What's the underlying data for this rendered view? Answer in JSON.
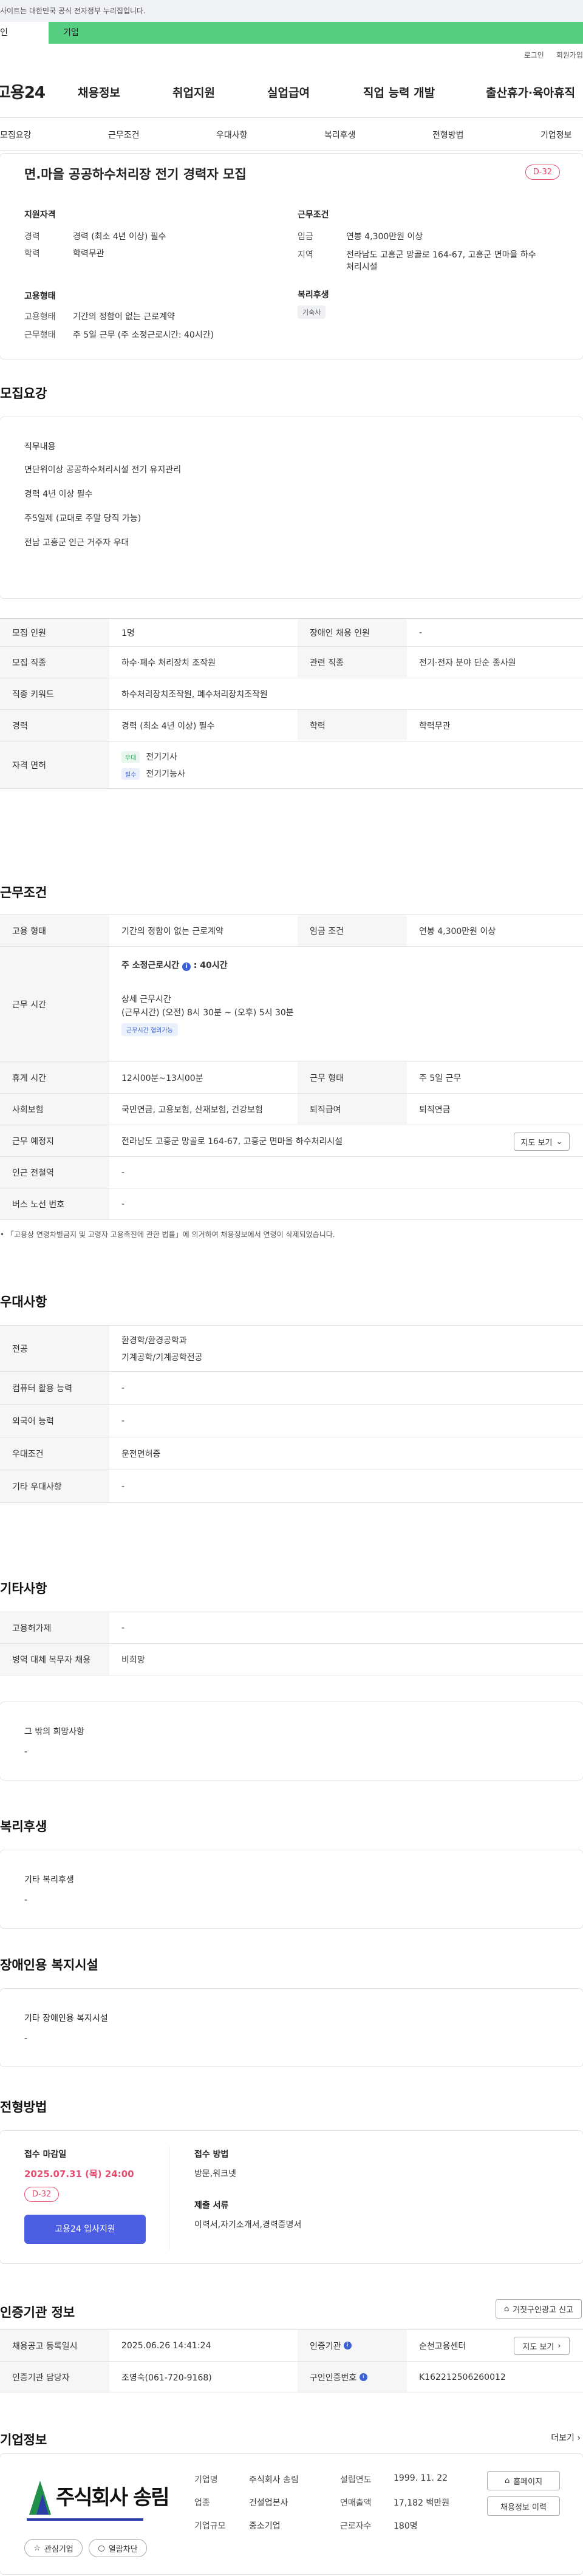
{
  "topbar": {
    "notice": "사이트는 대한민국 공식 전자정부 누리집입니다."
  },
  "tabs": {
    "first": "인",
    "second": "기업"
  },
  "util": {
    "login": "로그인",
    "join": "회원가입"
  },
  "gnb": {
    "logo": "고용24",
    "items": [
      "채용정보",
      "취업지원",
      "실업급여",
      "직업 능력 개발",
      "출산휴가·육아휴직"
    ]
  },
  "subnav": {
    "items": [
      "모집요강",
      "근무조건",
      "우대사항",
      "복리후생",
      "전형방법",
      "기업정보"
    ]
  },
  "header": {
    "title": "면.마을 공공하수처리장 전기 경력자 모집",
    "dday": "D-32",
    "qual_title": "지원자격",
    "qual_rows": [
      {
        "k": "경력",
        "v": "경력 (최소 4년 이상) 필수"
      },
      {
        "k": "학력",
        "v": "학력무관"
      }
    ],
    "cond_title": "근무조건",
    "cond_rows": [
      {
        "k": "임금",
        "v": "연봉 4,300만원 이상"
      },
      {
        "k": "지역",
        "v1": "전라남도 고흥군 망골로 164-67, 고흥군 면마을 하수",
        "v2": "처리시설"
      }
    ],
    "emp_title": "고용형태",
    "emp_rows": [
      {
        "k": "고용형태",
        "v": "기간의 정함이 없는 근로계약"
      },
      {
        "k": "근무형태",
        "v": "주 5일 근무 (주 소정근로시간: 40시간)"
      }
    ],
    "welfare_title": "복리후생",
    "welfare_chip": "기숙사"
  },
  "recruit": {
    "title": "모집요강",
    "job_title": "직무내용",
    "job_lines": [
      "면단위이상 공공하수처리시설 전기 유지관리",
      "경력 4년 이상 필수",
      "주5일제 (교대로 주말 당직 가능)",
      "전남 고흥군 인근 거주자 우대"
    ],
    "rows": [
      {
        "k": "모집 인원",
        "v": "1명",
        "k2": "장애인 채용 인원",
        "v2": "-"
      },
      {
        "k": "모집 직종",
        "v": "하수·폐수 처리장치 조작원",
        "k2": "관련 직종",
        "v2": "전기·전자 분야 단순 종사원"
      },
      {
        "k": "직종 키워드",
        "v": "하수처리장치조작원, 폐수처리장치조작원"
      },
      {
        "k": "경력",
        "v": "경력 (최소 4년 이상) 필수",
        "k2": "학력",
        "v2": "학력무관"
      },
      {
        "k": "자격 면허",
        "licenses": [
          {
            "tag": "우대",
            "name": "전기기사"
          },
          {
            "tag": "필수",
            "name": "전기기능사"
          }
        ]
      }
    ]
  },
  "work": {
    "title": "근무조건",
    "rows": [
      {
        "k": "고용 형태",
        "v": "기간의 정함이 없는 근로계약",
        "k2": "임금 조건",
        "v2": "연봉 4,300만원 이상"
      },
      {
        "k": "근무 시간",
        "weekly": "주 소정근로시간",
        "weekly_val": ": 40시간",
        "detail_title": "상세 근무시간",
        "detail": "(근무시간) (오전) 8시 30분 ~ (오후) 5시 30분",
        "consult": "근무시간 협의가능"
      },
      {
        "k": "휴게 시간",
        "v": "12시00분~13시00분",
        "k2": "근무 형태",
        "v2": "주 5일 근무"
      },
      {
        "k": "사회보험",
        "v": "국민연금, 고용보험, 산재보험, 건강보험",
        "k2": "퇴직급여",
        "v2": "퇴직연금"
      },
      {
        "k": "근무 예정지",
        "v": "전라남도 고흥군 망골로 164-67, 고흥군 면마을 하수처리시설",
        "btn": "지도 보기"
      },
      {
        "k": "인근 전철역",
        "v": "-"
      },
      {
        "k": "버스 노선 번호",
        "v": "-"
      }
    ],
    "note": "「고용상 연령차별금지 및 고령자 고용촉진에 관한 법률」에 의거하여 채용정보에서 연령이 삭제되었습니다."
  },
  "pref": {
    "title": "우대사항",
    "rows": [
      {
        "k": "전공",
        "v1": "환경학/환경공학과",
        "v2": "기계공학/기계공학전공"
      },
      {
        "k": "컴퓨터 활용 능력",
        "v": "-"
      },
      {
        "k": "외국어 능력",
        "v": "-"
      },
      {
        "k": "우대조건",
        "v": "운전면허증"
      },
      {
        "k": "기타 우대사항",
        "v": "-"
      }
    ]
  },
  "etc": {
    "title": "기타사항",
    "rows": [
      {
        "k": "고용허가제",
        "v": "-"
      },
      {
        "k": "병역 대체 복무자 채용",
        "v": "비희망"
      }
    ],
    "box_title": "그 밖의 희망사항",
    "box_val": "-"
  },
  "welfare": {
    "title": "복리후생",
    "box_title": "기타 복리후생",
    "box_val": "-"
  },
  "disability": {
    "title": "장애인용 복지시설",
    "box_title": "기타 장애인용 복지시설",
    "box_val": "-"
  },
  "screening": {
    "title": "전형방법",
    "deadline_label": "접수 마감일",
    "deadline": "2025.07.31 (목) 24:00",
    "dday": "D-32",
    "apply_btn": "고용24 입사지원",
    "method_label": "접수 방법",
    "method": "방문,워크넷",
    "docs_label": "제출 서류",
    "docs": "이력서,자기소개서,경력증명서"
  },
  "cert": {
    "title": "인증기관 정보",
    "report_btn": "거짓구인광고 신고",
    "rows": [
      {
        "k": "채용공고 등록일시",
        "v": "2025.06.26 14:41:24",
        "k2": "인증기관",
        "v2": "순천고용센터",
        "btn": "지도 보기"
      },
      {
        "k": "인증기관 담당자",
        "v": "조영숙(061-720-9168)",
        "k2": "구인인증번호",
        "v2": "K162212506260012"
      }
    ]
  },
  "company": {
    "title": "기업정보",
    "more": "더보기",
    "logo_text": "주식회사 송림",
    "fields": [
      {
        "k": "기업명",
        "v": "주식회사 송림",
        "k2": "설립연도",
        "v2": "1999. 11. 22"
      },
      {
        "k": "업종",
        "v": "건설업본사",
        "k2": "연매출액",
        "v2": "17,182 백만원"
      },
      {
        "k": "기업규모",
        "v": "중소기업",
        "k2": "근로자수",
        "v2": "180명"
      }
    ],
    "btn_interest": "관심기업",
    "btn_block": "열람차단",
    "btn_home": "홈페이지",
    "btn_jobs": "채용정보 이력"
  },
  "colors": {
    "accent": "#56cf83",
    "dday": "#e64a6d",
    "primary": "#4b5ee4",
    "info": "#3b62d6"
  }
}
